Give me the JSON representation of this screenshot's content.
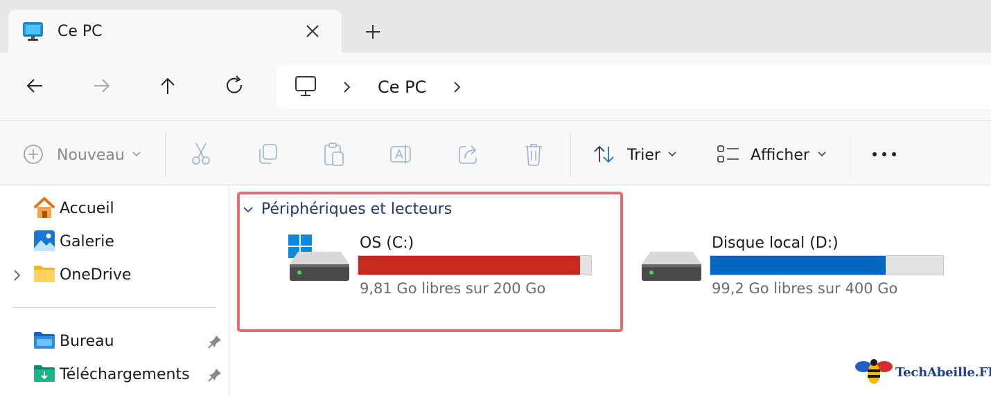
{
  "tab": {
    "title": "Ce PC",
    "close_icon": "close-icon",
    "new_tab_icon": "plus-icon"
  },
  "nav": {
    "back_icon": "arrow-left-icon",
    "forward_icon": "arrow-right-icon",
    "up_icon": "arrow-up-icon",
    "refresh_icon": "refresh-icon"
  },
  "address": {
    "location_icon": "monitor-icon",
    "crumb": "Ce PC"
  },
  "toolbar": {
    "new_label": "Nouveau",
    "sort_label": "Trier",
    "view_label": "Afficher",
    "more_icon": "more-icon"
  },
  "sidebar": {
    "items": [
      {
        "label": "Accueil",
        "icon": "home-icon"
      },
      {
        "label": "Galerie",
        "icon": "gallery-icon"
      },
      {
        "label": "OneDrive",
        "icon": "folder-icon"
      }
    ],
    "pinned": [
      {
        "label": "Bureau",
        "icon": "desktop-folder-icon"
      },
      {
        "label": "Téléchargements",
        "icon": "downloads-folder-icon"
      }
    ]
  },
  "main": {
    "section_title": "Périphériques et lecteurs",
    "drives": [
      {
        "name": "OS (C:)",
        "space": "9,81 Go libres sur 200 Go",
        "used_fraction": 0.951,
        "bar_color": "#c42b1c"
      },
      {
        "name": "Disque local (D:)",
        "space": "99,2 Go libres sur 400 Go",
        "used_fraction": 0.752,
        "bar_color": "#0067c0"
      }
    ]
  },
  "watermark": {
    "text": "TechAbeille.FR"
  },
  "colors": {
    "accent": "#0067c0",
    "warning": "#c42b1c",
    "highlight": "#e86b6b"
  }
}
